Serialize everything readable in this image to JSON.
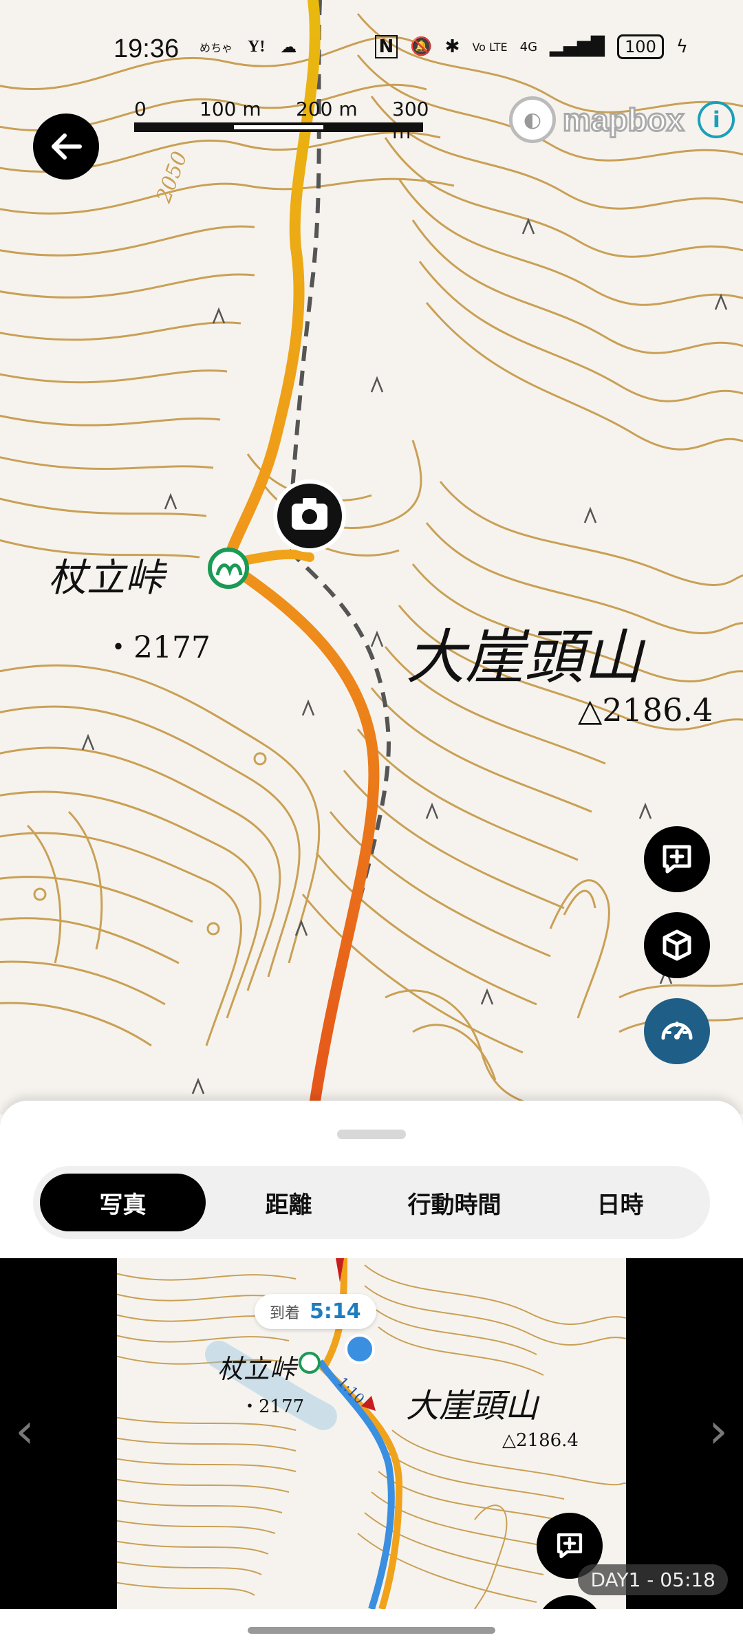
{
  "status_bar": {
    "time": "19:36",
    "left_icons": [
      "めちゃ",
      "Y!",
      "cloud-icon"
    ],
    "right_icons": [
      "N",
      "mute-icon",
      "bluetooth-icon",
      "Vo LTE",
      "4G",
      "signal-icon"
    ],
    "battery": "100"
  },
  "scale_bar": {
    "labels": [
      "0",
      "100 m",
      "200 m",
      "300 m"
    ]
  },
  "attribution": {
    "brand": "mapbox",
    "info_symbol": "i"
  },
  "map": {
    "labels": {
      "pass_name": "杖立峠",
      "spot_height": "・2177",
      "mountain_name": "大崖頭山",
      "triangulation_point": "△2186.4",
      "contour_number": "2050"
    },
    "route_colors": {
      "start": "#e8b90f",
      "mid": "#f09a1a",
      "end": "#e5541a"
    },
    "contour_color": "#c9a055"
  },
  "sheet": {
    "tabs": [
      {
        "label": "写真",
        "active": true
      },
      {
        "label": "距離",
        "active": false
      },
      {
        "label": "行動時間",
        "active": false
      },
      {
        "label": "日時",
        "active": false
      }
    ],
    "photo": {
      "arrival_label": "到着",
      "arrival_time": "5:14",
      "day_label": "DAY1 - 05:18",
      "map_labels": {
        "pass_name": "杖立峠",
        "spot_height": "・2177",
        "mountain_name": "大崖頭山",
        "triangulation_point": "△2186.4",
        "route_marker": "1:10"
      }
    }
  },
  "nav": {
    "prev": "‹",
    "next": "›"
  }
}
